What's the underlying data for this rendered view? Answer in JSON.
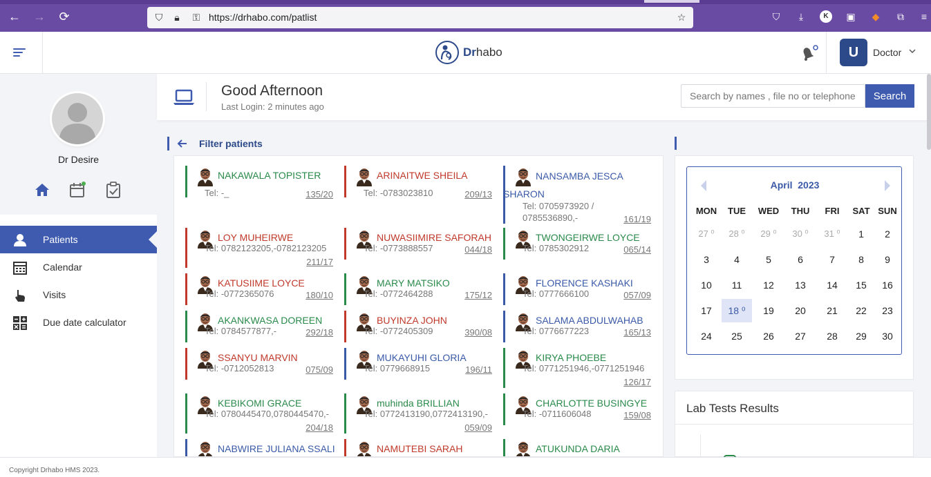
{
  "browser": {
    "url": "https://drhabo.com/patlist"
  },
  "header": {
    "logo_prefix": "Dr",
    "logo_suffix": "habo",
    "user_initial": "U",
    "user_role": "Doctor"
  },
  "sidebar": {
    "doctor_name": "Dr Desire",
    "menu": [
      {
        "label": "Patients",
        "icon": "user-icon",
        "active": true
      },
      {
        "label": "Calendar",
        "icon": "calendar-grid-icon",
        "active": false
      },
      {
        "label": "Visits",
        "icon": "hand-pointer-icon",
        "active": false
      },
      {
        "label": "Due date calculator",
        "icon": "calculator-icon",
        "active": false
      }
    ]
  },
  "greeting": {
    "title": "Good Afternoon",
    "last_login": "Last Login: 2 minutes ago"
  },
  "search": {
    "placeholder": "Search by names , file no or telephone",
    "button": "Search"
  },
  "filter": {
    "title": "Filter patients"
  },
  "patients": [
    {
      "name": "NAKAWALA TOPISTER",
      "tel": "Tel: -_",
      "file_no": "135/20",
      "color": "green"
    },
    {
      "name": "ARINAITWE SHEILA",
      "tel": "Tel: -0783023810",
      "file_no": "209/13",
      "color": "red"
    },
    {
      "name": "NANSAMBA JESCA SHARON",
      "tel": "Tel: 0705973920 / 0785536890,-",
      "file_no": "161/19",
      "color": "blue"
    },
    {
      "name": "LOY MUHEIRWE",
      "tel": "Tel: 0782123205,-0782123205",
      "file_no": "211/17",
      "color": "red"
    },
    {
      "name": "NUWASIIMIRE SAFORAH",
      "tel": "Tel: -0773888557",
      "file_no": "044/18",
      "color": "red"
    },
    {
      "name": "TWONGEIRWE LOYCE",
      "tel": "Tel: 0785302912",
      "file_no": "065/14",
      "color": "green"
    },
    {
      "name": "KATUSIIME LOYCE",
      "tel": "Tel: -0772365076",
      "file_no": "180/10",
      "color": "red"
    },
    {
      "name": "MARY MATSIKO",
      "tel": "Tel: -0772464288",
      "file_no": "175/12",
      "color": "green"
    },
    {
      "name": "FLORENCE KASHAKI",
      "tel": "Tel: 0777666100",
      "file_no": "057/09",
      "color": "blue"
    },
    {
      "name": "AKANKWASA DOREEN",
      "tel": "Tel: 0784577877,-",
      "file_no": "292/18",
      "color": "green"
    },
    {
      "name": "BUYINZA JOHN",
      "tel": "Tel: -0772405309",
      "file_no": "390/08",
      "color": "red"
    },
    {
      "name": "SALAMA ABDULWAHAB",
      "tel": "Tel: 0776677223",
      "file_no": "165/13",
      "color": "blue"
    },
    {
      "name": "SSANYU MARVIN",
      "tel": "Tel: -0712052813",
      "file_no": "075/09",
      "color": "red"
    },
    {
      "name": "MUKAYUHI GLORIA",
      "tel": "Tel: 0779668915",
      "file_no": "196/11",
      "color": "blue"
    },
    {
      "name": "KIRYA PHOEBE",
      "tel": "Tel: 0771251946,-0771251946",
      "file_no": "126/17",
      "color": "green"
    },
    {
      "name": "KEBIKOMI GRACE",
      "tel": "Tel: 0780445470,0780445470,-",
      "file_no": "204/18",
      "color": "green"
    },
    {
      "name": "muhinda BRILLIAN",
      "tel": "Tel: 0772413190,0772413190,-",
      "file_no": "059/09",
      "color": "green"
    },
    {
      "name": "CHARLOTTE BUSINGYE",
      "tel": "Tel: -0711606048",
      "file_no": "159/08",
      "color": "green"
    },
    {
      "name": "NABWIRE JULIANA SSALI",
      "tel": "",
      "file_no": "",
      "color": "blue"
    },
    {
      "name": "NAMUTEBI SARAH",
      "tel": "",
      "file_no": "",
      "color": "red"
    },
    {
      "name": "ATUKUNDA DARIA",
      "tel": "",
      "file_no": "",
      "color": "green"
    }
  ],
  "calendar": {
    "month": "April",
    "year": "2023",
    "days_of_week": [
      "MON",
      "TUE",
      "WED",
      "THU",
      "FRI",
      "SAT",
      "SUN"
    ],
    "weeks": [
      [
        "27 ⁰",
        "28 ⁰",
        "29 ⁰",
        "30 ⁰",
        "31 ⁰",
        "1",
        "2"
      ],
      [
        "3",
        "4",
        "5",
        "6",
        "7",
        "8",
        "9"
      ],
      [
        "10",
        "11",
        "12",
        "13",
        "14",
        "15",
        "16"
      ],
      [
        "17",
        "18 ⁰",
        "19",
        "20",
        "21",
        "22",
        "23"
      ],
      [
        "24",
        "25",
        "26",
        "27",
        "28",
        "29",
        "30"
      ]
    ]
  },
  "lab": {
    "title": "Lab Tests Results"
  },
  "footer": {
    "copyright": "Copyright Drhabo HMS 2023."
  }
}
